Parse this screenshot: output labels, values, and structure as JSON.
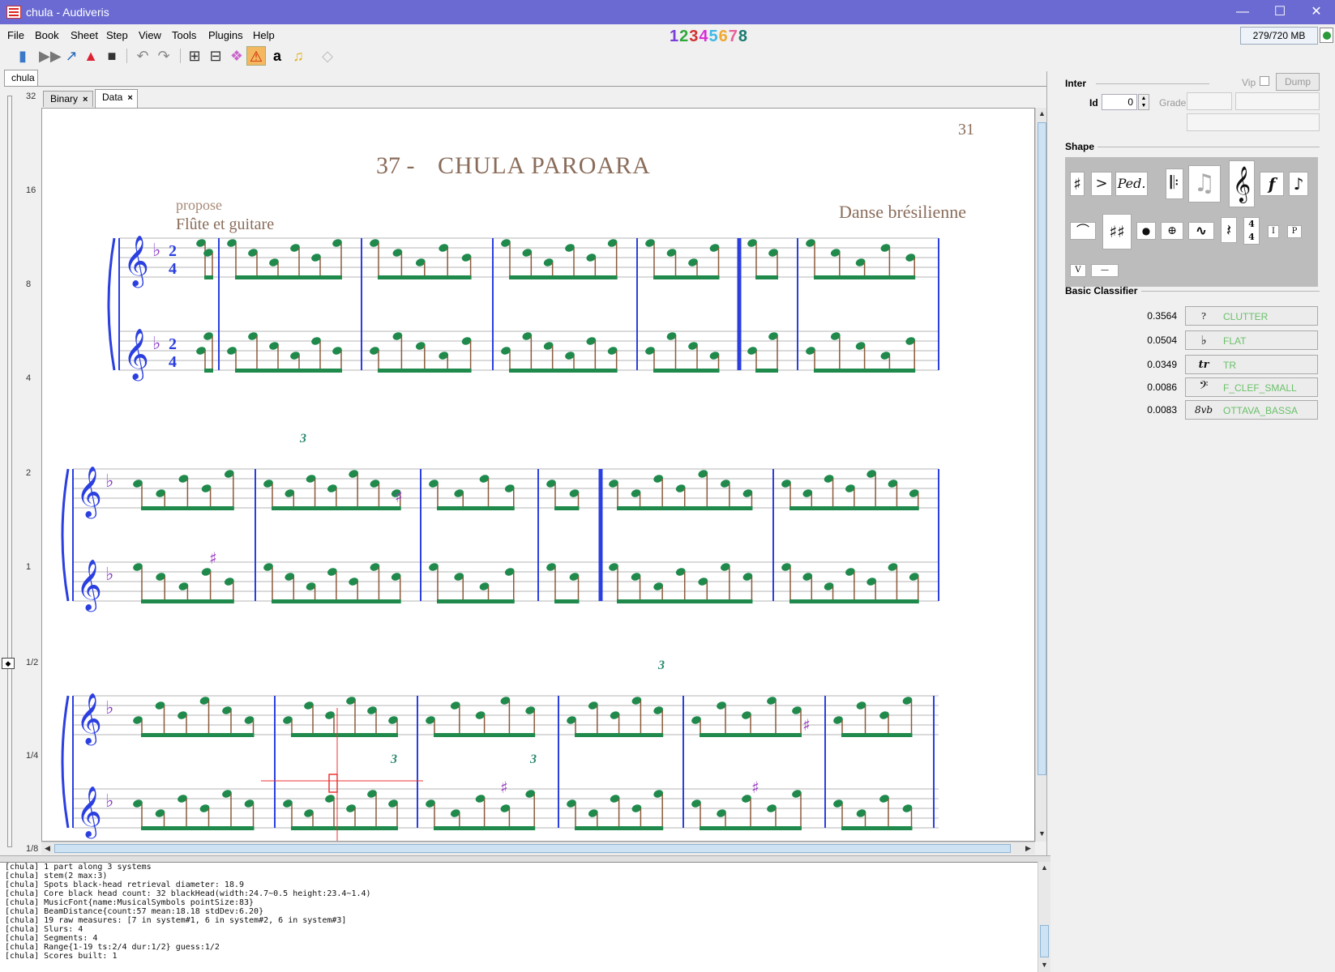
{
  "window": {
    "title": "chula - Audiveris",
    "minimize": "—",
    "maximize": "☐",
    "close": "✕"
  },
  "menu": [
    "File",
    "Book",
    "Sheet",
    "Step",
    "View",
    "Tools",
    "Plugins",
    "Help"
  ],
  "step_numbers": [
    {
      "label": "1",
      "color": "#7a3fd6"
    },
    {
      "label": "2",
      "color": "#2fa83a"
    },
    {
      "label": "3",
      "color": "#d12f2f"
    },
    {
      "label": "4",
      "color": "#d62fd6"
    },
    {
      "label": "5",
      "color": "#3fb8e6"
    },
    {
      "label": "6",
      "color": "#f0a830"
    },
    {
      "label": "7",
      "color": "#e8609a"
    },
    {
      "label": "8",
      "color": "#1a7a70"
    }
  ],
  "memory": "279/720 MB",
  "toolbar_icons": [
    "open-book-icon",
    "run-all-icon",
    "export-icon",
    "pdf-icon",
    "save-icon",
    "undo-icon",
    "redo-icon",
    "grid-icon",
    "split-icon",
    "color-icon",
    "warning-icon",
    "text-icon",
    "music-icon",
    "eraser-icon"
  ],
  "book_tab": "chula",
  "sheet_tabs": [
    {
      "label": "Binary",
      "close": "×"
    },
    {
      "label": "Data",
      "close": "×"
    }
  ],
  "ruler_labels": [
    "32",
    "16",
    "8",
    "4",
    "2",
    "1",
    "1/2",
    "1/4",
    "1/8"
  ],
  "score": {
    "page_number": "31",
    "title_prefix": "37 -",
    "title_main": "CHULA   PAROARA",
    "subtitle_ghost": "propose",
    "instruments": "Flûte et guitare",
    "style": "Danse brésilienne",
    "time_sig_top": "2",
    "time_sig_bottom": "4",
    "tuplet": "3"
  },
  "inter": {
    "title": "Inter",
    "vip_label": "Vip",
    "dump_label": "Dump",
    "id_label": "Id",
    "id_value": "0",
    "grade_label": "Grade"
  },
  "shape": {
    "title": "Shape",
    "symbols": [
      "♯",
      ">",
      "𝆮",
      "𝄃",
      "♫",
      "𝄞",
      "𝆑",
      "♪",
      "𝄐",
      "♯♯",
      "●",
      "⊕",
      "∿",
      "𝄽",
      "4/4",
      "I",
      "P",
      "V",
      "—"
    ]
  },
  "classifier": {
    "title": "Basic Classifier",
    "rows": [
      {
        "score": "0.3564",
        "glyph": "?",
        "name": "CLUTTER"
      },
      {
        "score": "0.0504",
        "glyph": "♭",
        "name": "FLAT"
      },
      {
        "score": "0.0349",
        "glyph": "tr",
        "name": "TR"
      },
      {
        "score": "0.0086",
        "glyph": "𝄢",
        "name": "F_CLEF_SMALL"
      },
      {
        "score": "0.0083",
        "glyph": "8vb",
        "name": "OTTAVA_BASSA"
      }
    ]
  },
  "log_lines": [
    "[chula] 1 part along 3 systems",
    "[chula] stem(2 max:3)",
    "[chula] Spots black-head retrieval diameter: 18.9",
    "[chula] Core black head count: 32 blackHead(width:24.7~0.5 height:23.4~1.4)",
    "[chula] MusicFont{name:MusicalSymbols pointSize:83}",
    "[chula] BeamDistance{count:57 mean:18.18 stdDev:6.20}",
    "[chula] 19 raw measures: [7 in system#1, 6 in system#2, 6 in system#3]",
    "[chula] Slurs: 4",
    "[chula] Segments: 4",
    "[chula] Range{1-19 ts:2/4 dur:1/2} guess:1/2",
    "[chula] Scores built: 1"
  ]
}
